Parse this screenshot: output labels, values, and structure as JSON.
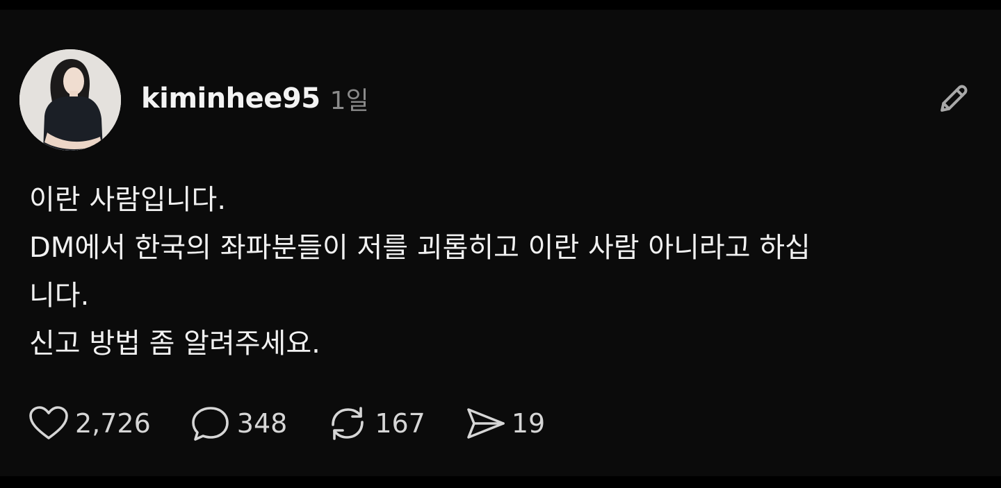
{
  "post": {
    "username": "kiminhee95",
    "timestamp": "1일",
    "lines": [
      "이란 사람입니다.",
      "DM에서 한국의 좌파분들이 저를 괴롭히고 이란 사람 아니라고 하십",
      "니다.",
      "신고 방법 좀 알려주세요."
    ]
  },
  "actions": {
    "likes": "2,726",
    "comments": "348",
    "reposts": "167",
    "shares": "19"
  },
  "icons": {
    "edit": "pencil-icon",
    "like": "heart-icon",
    "comment": "comment-bubble-icon",
    "repost": "repost-icon",
    "share": "send-icon"
  },
  "colors": {
    "background": "#0b0b0b",
    "text": "#f1f1f1",
    "muted": "#8a8a8a",
    "icon": "#d6d6d6"
  }
}
